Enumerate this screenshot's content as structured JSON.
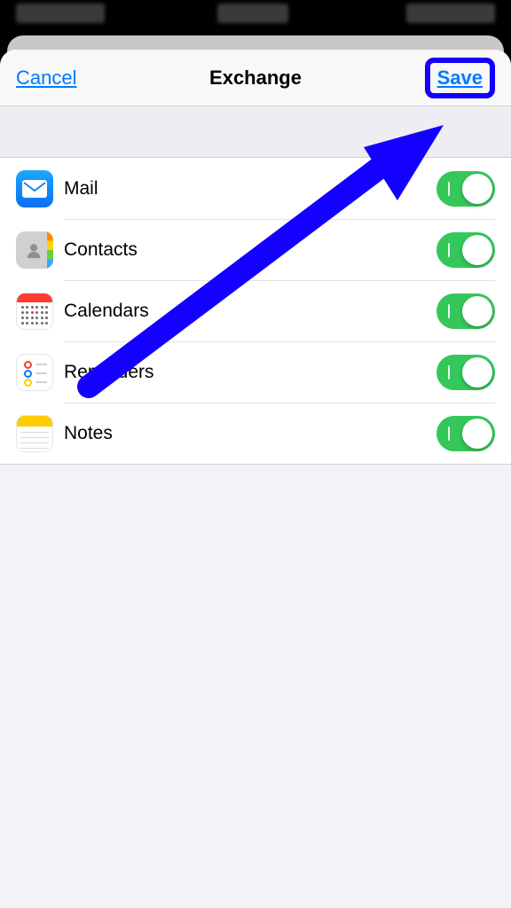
{
  "navbar": {
    "cancel_label": "Cancel",
    "title": "Exchange",
    "save_label": "Save"
  },
  "items": [
    {
      "label": "Mail",
      "icon": "mail-icon",
      "on": true
    },
    {
      "label": "Contacts",
      "icon": "contacts-icon",
      "on": true
    },
    {
      "label": "Calendars",
      "icon": "calendar-icon",
      "on": true
    },
    {
      "label": "Reminders",
      "icon": "reminders-icon",
      "on": true
    },
    {
      "label": "Notes",
      "icon": "notes-icon",
      "on": true
    }
  ],
  "annotation": {
    "type": "arrow",
    "color": "#1400ff",
    "target": "save-button"
  }
}
